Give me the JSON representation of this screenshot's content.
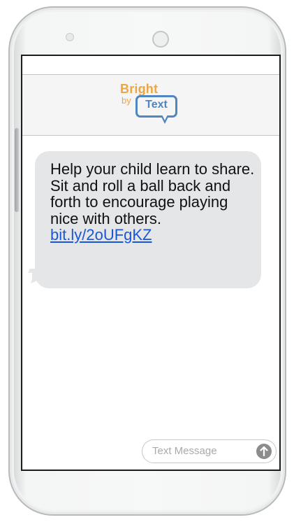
{
  "logo": {
    "bright": "Bright",
    "by": "by",
    "text": "Text"
  },
  "message": {
    "body": "Help your child learn to share. Sit and roll a ball back and forth to encourage playing nice with others.",
    "link": "bit.ly/2oUFgKZ"
  },
  "composer": {
    "placeholder": "Text Message"
  },
  "colors": {
    "brand_orange": "#f0a63f",
    "brand_blue": "#4f86bf",
    "bubble_gray": "#e5e6e8",
    "link_blue": "#1a56d6"
  },
  "icons": {
    "send": "arrow-up-icon"
  }
}
